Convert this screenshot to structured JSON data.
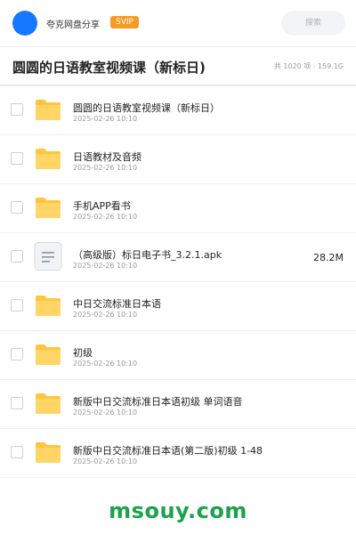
{
  "header": {
    "app_name": "夸克网盘分享",
    "badge": "SVIP",
    "search_placeholder": "搜索"
  },
  "title": {
    "text": "圆圆的日语教室视频课（新标日)",
    "meta": "共 1020 项 · 159.1G"
  },
  "files": [
    {
      "name": "圆圆的日语教室视频课（新标日）",
      "date": "2025-02-26 10:10",
      "type": "folder",
      "size": ""
    },
    {
      "name": "日语教材及音频",
      "date": "2025-02-26 10:10",
      "type": "folder",
      "size": ""
    },
    {
      "name": "手机APP看书",
      "date": "2025-02-26 10:10",
      "type": "folder",
      "size": ""
    },
    {
      "name": "（高级版）标日电子书_3.2.1.apk",
      "date": "2025-02-26 10:10",
      "type": "file",
      "size": "28.2M"
    },
    {
      "name": "中日交流标准日本语",
      "date": "2025-02-26 10:10",
      "type": "folder",
      "size": ""
    },
    {
      "name": "初级",
      "date": "2025-02-26 10:10",
      "type": "folder",
      "size": ""
    },
    {
      "name": "新版中日交流标准日本语初级 单词语音",
      "date": "2025-02-26 10:10",
      "type": "folder",
      "size": ""
    },
    {
      "name": "新版中日交流标准日本语(第二版)初级 1-48",
      "date": "2025-02-26 10:10",
      "type": "folder",
      "size": ""
    }
  ],
  "watermark": "msouy.com",
  "colors": {
    "avatar": "#1677ff",
    "badge": "#f59a23",
    "folder": "#ffc53d",
    "watermark": "#1aa34a"
  }
}
